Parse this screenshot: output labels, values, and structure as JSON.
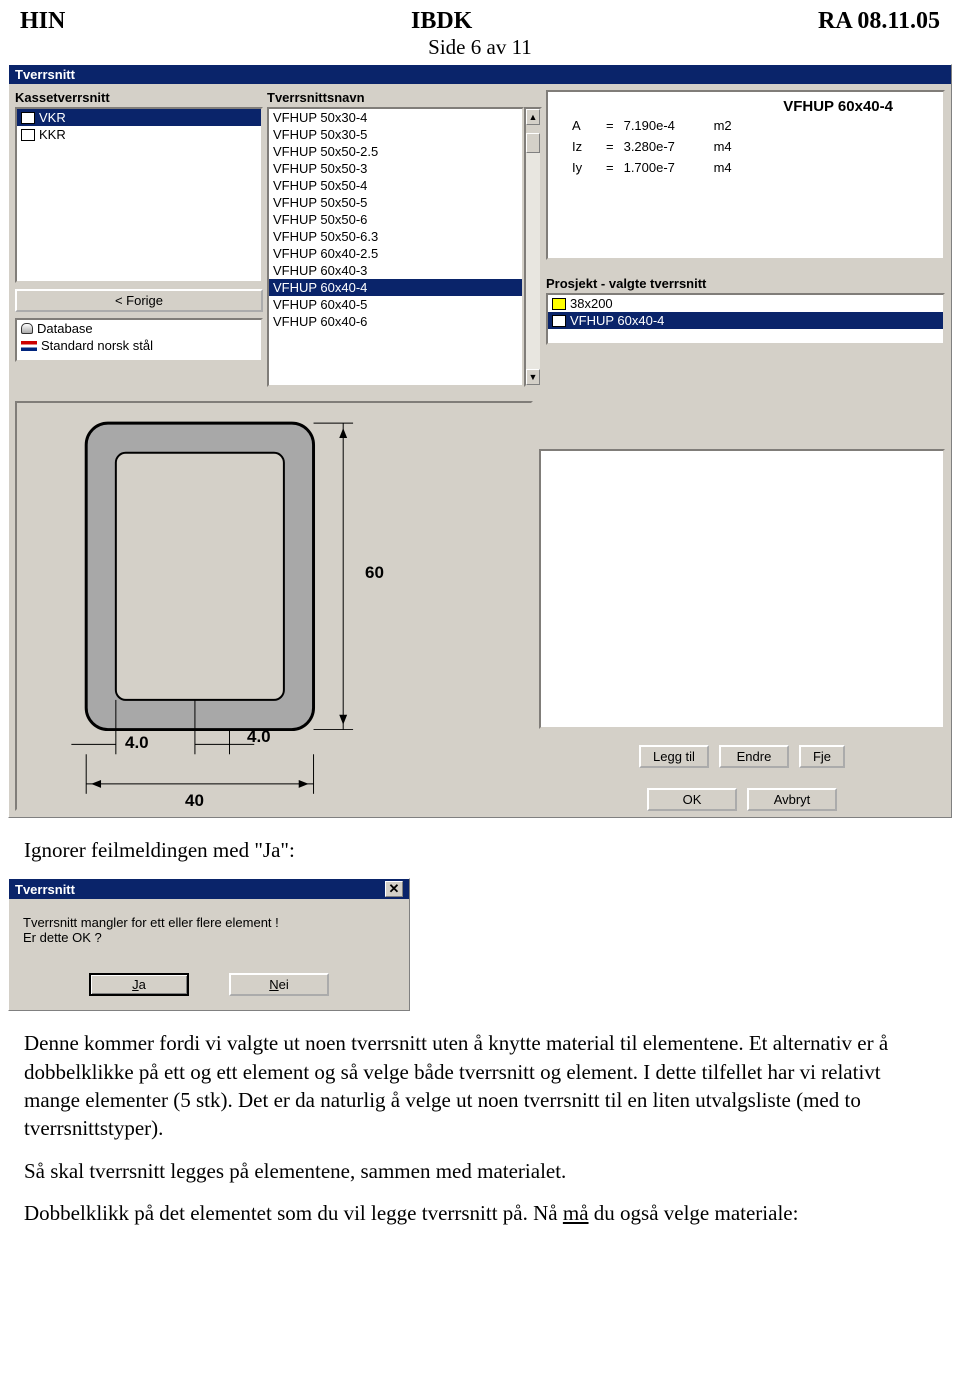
{
  "header": {
    "left": "HIN",
    "center": "IBDK",
    "right": "RA 08.11.05",
    "sub": "Side 6 av 11"
  },
  "mainDialog": {
    "title": "Tverrsnitt",
    "kasse_label": "Kassetverrsnitt",
    "kasse_items": [
      "VKR",
      "KKR"
    ],
    "kasse_sel": 0,
    "back_btn": "< Forige",
    "db_label": "Database",
    "std_label": "Standard norsk stål",
    "tnavn_label": "Tverrsnittsnavn",
    "tnavn_items": [
      "VFHUP 50x30-4",
      "VFHUP 50x30-5",
      "VFHUP 50x50-2.5",
      "VFHUP 50x50-3",
      "VFHUP 50x50-4",
      "VFHUP 50x50-5",
      "VFHUP 50x50-6",
      "VFHUP 50x50-6.3",
      "VFHUP 60x40-2.5",
      "VFHUP 60x40-3",
      "VFHUP 60x40-4",
      "VFHUP 60x40-5",
      "VFHUP 60x40-6"
    ],
    "tnavn_sel": 10,
    "props": {
      "title": "VFHUP 60x40-4",
      "rows": [
        {
          "k": "A",
          "op": "=",
          "v": "7.190e-4",
          "u": "m2"
        },
        {
          "k": "Iz",
          "op": "=",
          "v": "3.280e-7",
          "u": "m4"
        },
        {
          "k": "Iy",
          "op": "=",
          "v": "1.700e-7",
          "u": "m4"
        }
      ]
    },
    "proj_label": "Prosjekt - valgte tverrsnitt",
    "proj_items": [
      "38x200",
      "VFHUP 60x40-4"
    ],
    "proj_sel": 1,
    "btn_add": "Legg til",
    "btn_edit": "Endre",
    "btn_del": "Fje",
    "btn_ok": "OK",
    "btn_cancel": "Avbryt",
    "dims": {
      "h": "60",
      "w": "40",
      "t1": "4.0",
      "t2": "4.0"
    }
  },
  "para1": "Ignorer feilmeldingen med \"Ja\":",
  "msgDialog": {
    "title": "Tverrsnitt",
    "line1": "Tverrsnitt mangler for ett eller flere element !",
    "line2": "Er dette OK ?",
    "btn_yes": "Ja",
    "btn_no": "Nei"
  },
  "para2": "Denne kommer fordi vi valgte ut noen tverrsnitt uten å knytte material til elementene. Et alternativ er å dobbelklikke på ett og ett element og så velge både tverrsnitt og element. I dette tilfellet har vi relativt mange elementer (5 stk). Det er da naturlig å velge ut noen tverrsnitt til en liten utvalgsliste (med to tverrsnittstyper).",
  "para3": "Så skal tverrsnitt legges på elementene, sammen med materialet.",
  "para4a": "Dobbelklikk på det elementet som du vil legge tverrsnitt på. Nå ",
  "para4b": "må",
  "para4c": " du også velge materiale:"
}
